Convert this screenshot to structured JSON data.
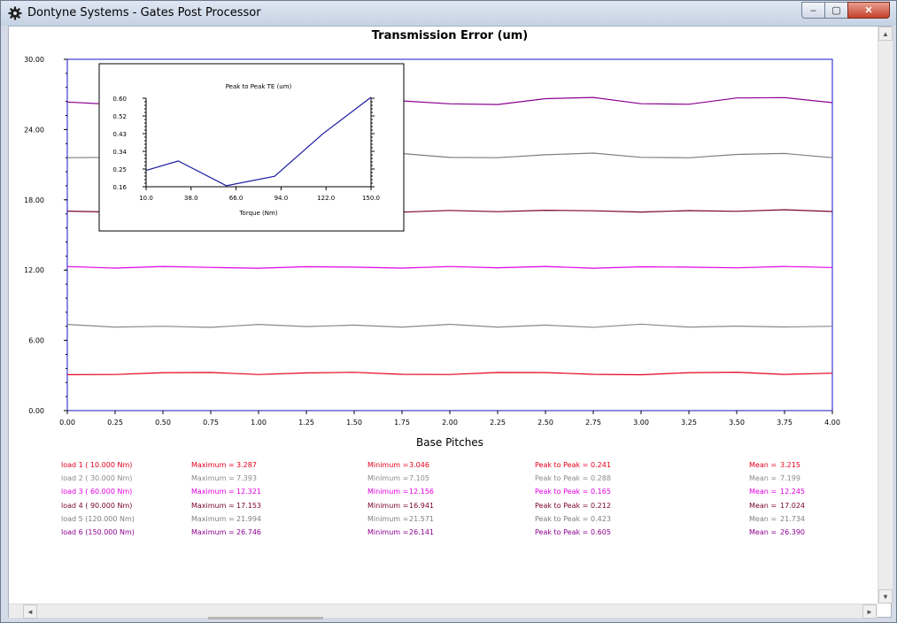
{
  "window": {
    "title": "Dontyne Systems - Gates Post Processor",
    "icon": "gear-icon",
    "controls": {
      "minimize": "‒",
      "maximize": "▢",
      "close": "✕"
    }
  },
  "chart_data": [
    {
      "type": "line",
      "title": "Transmission Error (um)",
      "xlabel": "Base Pitches",
      "ylabel": "",
      "xlim": [
        0,
        4
      ],
      "ylim": [
        0,
        30
      ],
      "x_ticks": [
        "0.00",
        "0.25",
        "0.50",
        "0.75",
        "1.00",
        "1.25",
        "1.50",
        "1.75",
        "2.00",
        "2.25",
        "2.50",
        "2.75",
        "3.00",
        "3.25",
        "3.50",
        "3.75",
        "4.00"
      ],
      "y_ticks": [
        "0.00",
        "6.00",
        "12.00",
        "18.00",
        "24.00",
        "30.00"
      ],
      "grid": false,
      "x": [
        0.0,
        0.25,
        0.5,
        0.75,
        1.0,
        1.25,
        1.5,
        1.75,
        2.0,
        2.25,
        2.5,
        2.75,
        3.0,
        3.25,
        3.5,
        3.75,
        4.0
      ],
      "series": [
        {
          "name": "load 1 ( 10.000 Nm)",
          "color": "#e3001b",
          "values": [
            3.07,
            3.08,
            3.24,
            3.26,
            3.08,
            3.22,
            3.27,
            3.1,
            3.08,
            3.26,
            3.25,
            3.1,
            3.06,
            3.24,
            3.28,
            3.09,
            3.2
          ]
        },
        {
          "name": "load 2 ( 30.000 Nm)",
          "color": "#8a8a8a",
          "values": [
            7.36,
            7.13,
            7.2,
            7.11,
            7.36,
            7.18,
            7.3,
            7.13,
            7.37,
            7.13,
            7.3,
            7.12,
            7.38,
            7.13,
            7.22,
            7.14,
            7.2
          ]
        },
        {
          "name": "load 3 ( 60.000 Nm)",
          "color": "#e100e1",
          "values": [
            12.3,
            12.17,
            12.31,
            12.23,
            12.16,
            12.29,
            12.25,
            12.17,
            12.3,
            12.2,
            12.31,
            12.16,
            12.28,
            12.25,
            12.19,
            12.31,
            12.22
          ]
        },
        {
          "name": "load 4 ( 90.000 Nm)",
          "color": "#7a0030",
          "values": [
            17.03,
            16.95,
            17.1,
            17.05,
            16.97,
            17.12,
            17.04,
            16.95,
            17.09,
            16.99,
            17.11,
            17.06,
            16.96,
            17.08,
            17.02,
            17.15,
            17.0
          ]
        },
        {
          "name": "load 5 (120.000 Nm)",
          "color": "#7f7f7f",
          "values": [
            21.6,
            21.63,
            21.82,
            21.97,
            21.76,
            21.66,
            21.93,
            21.95,
            21.62,
            21.6,
            21.85,
            21.99,
            21.63,
            21.59,
            21.88,
            21.96,
            21.6
          ]
        },
        {
          "name": "load 6 (150.000 Nm)",
          "color": "#8b0090",
          "values": [
            26.35,
            26.14,
            26.6,
            26.72,
            26.43,
            26.18,
            26.7,
            26.45,
            26.2,
            26.14,
            26.64,
            26.74,
            26.21,
            26.16,
            26.7,
            26.73,
            26.3
          ]
        }
      ]
    },
    {
      "type": "line",
      "title": "Peak to Peak TE (um)",
      "xlabel": "Torque (Nm)",
      "ylabel": "",
      "xlim": [
        10,
        150
      ],
      "ylim": [
        0.16,
        0.6
      ],
      "x_ticks": [
        "10.0",
        "38.0",
        "66.0",
        "94.0",
        "122.0",
        "150.0"
      ],
      "y_ticks": [
        "0.16",
        "0.25",
        "0.34",
        "0.43",
        "0.52",
        "0.60"
      ],
      "grid": false,
      "x": [
        10,
        30,
        60,
        90,
        120,
        150
      ],
      "series": [
        {
          "name": "",
          "color": "#1a1aa0",
          "values": [
            0.241,
            0.288,
            0.165,
            0.212,
            0.423,
            0.605
          ]
        }
      ]
    }
  ],
  "stats": {
    "label_maximum": "Maximum =",
    "label_minimum": "Minimum =",
    "label_p2p": "Peak to Peak =",
    "label_mean": "Mean =",
    "rows": [
      {
        "load": "load  1 ( 10.000 Nm)",
        "maximum": "3.287",
        "minimum": "3.046",
        "p2p": "0.241",
        "mean": "3.215",
        "color": "#e3001b"
      },
      {
        "load": "load  2 ( 30.000 Nm)",
        "maximum": "7.393",
        "minimum": "7.105",
        "p2p": "0.288",
        "mean": "7.199",
        "color": "#8a8a8a"
      },
      {
        "load": "load  3 ( 60.000 Nm)",
        "maximum": "12.321",
        "minimum": "12.156",
        "p2p": "0.165",
        "mean": "12.245",
        "color": "#e100e1"
      },
      {
        "load": "load  4 ( 90.000 Nm)",
        "maximum": "17.153",
        "minimum": "16.941",
        "p2p": "0.212",
        "mean": "17.024",
        "color": "#7a0030"
      },
      {
        "load": "load  5 (120.000 Nm)",
        "maximum": "21.994",
        "minimum": "21.571",
        "p2p": "0.423",
        "mean": "21.734",
        "color": "#7f7f7f"
      },
      {
        "load": "load  6 (150.000 Nm)",
        "maximum": "26.746",
        "minimum": "26.141",
        "p2p": "0.605",
        "mean": "26.390",
        "color": "#8b0090"
      }
    ]
  },
  "scrollbars": {
    "up": "▲",
    "down": "▼",
    "left": "◄",
    "right": "►"
  }
}
